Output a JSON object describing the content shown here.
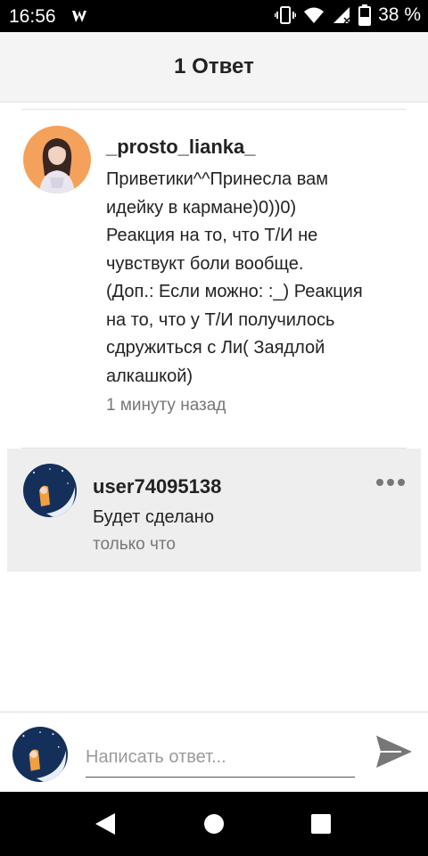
{
  "status_bar": {
    "time": "16:56",
    "battery": "38 %",
    "icons": [
      "wattpad-logo",
      "vibrate-icon",
      "wifi-icon",
      "signal-icon",
      "battery-icon"
    ]
  },
  "header": {
    "title": "1 Ответ"
  },
  "comment": {
    "username": "_prosto_lianka_",
    "body": "Приветики^^Принесла вам\nидейку в кармане)0))0)\nРеакция на то, что Т/И не\nчувствукт боли вообще.\n(Доп.: Если можно: :_) Реакция\nна то, что у Т/И получилось\nсдружиться с Ли( Заядлой\nалкашкой)",
    "time": "1 минуту назад"
  },
  "reply": {
    "username": "user74095138",
    "body": "Будет сделано",
    "time": "только что"
  },
  "compose": {
    "placeholder": "Написать ответ...",
    "value": ""
  },
  "colors": {
    "header_bg": "#f4f4f4",
    "reply_bg": "#eeeeef",
    "avatar1_bg": "#f4a25b",
    "avatar2_bg": "#14305a"
  }
}
